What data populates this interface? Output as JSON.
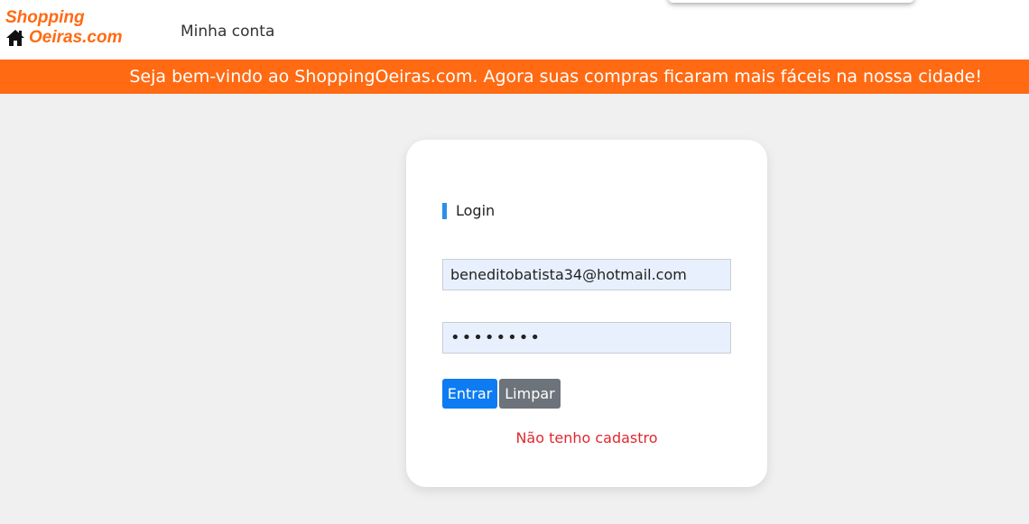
{
  "navbar": {
    "logo_line1": "Shopping",
    "logo_line2": "Oeiras.com",
    "logo_icon": "home-icon",
    "account_link": "Minha conta"
  },
  "banner": {
    "text": "Seja bem-vindo ao ShoppingOeiras.com. Agora suas compras ficaram mais fáceis na nossa cidade!"
  },
  "login": {
    "title": "Login",
    "email_value": "beneditobatista34@hotmail.com",
    "password_value": "••••••••",
    "submit_label": "Entrar",
    "clear_label": "Limpar",
    "register_link": "Não tenho cadastro"
  },
  "colors": {
    "brand_orange": "#ff6a13",
    "primary_blue": "#0d7cf2",
    "secondary_gray": "#6c737a",
    "link_red": "#e0282f",
    "title_accent": "#2b8fe8"
  }
}
